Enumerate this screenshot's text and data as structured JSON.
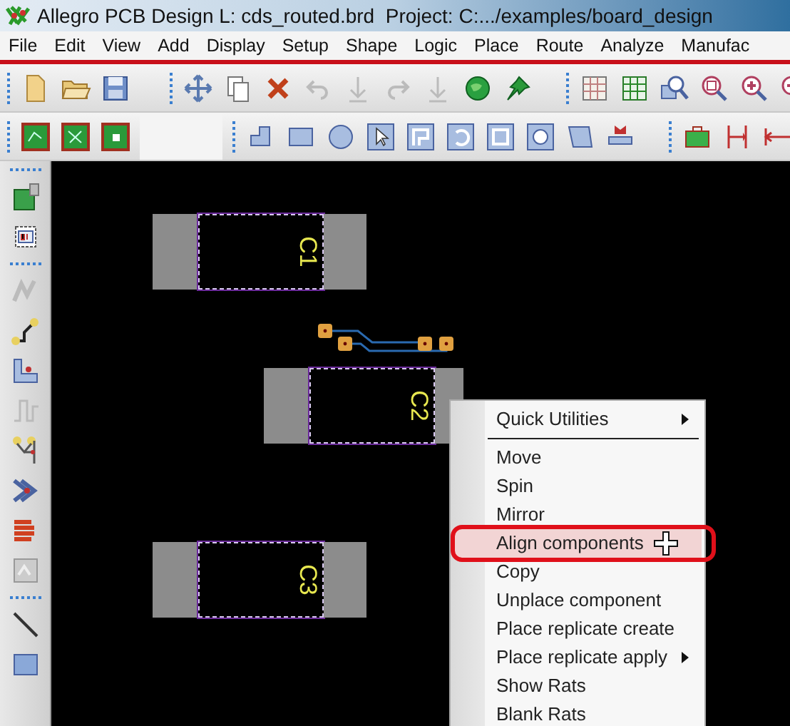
{
  "window": {
    "title": "Allegro PCB Design L: cds_routed.brd  Project: C:.../examples/board_design"
  },
  "menu_bar": [
    "File",
    "Edit",
    "View",
    "Add",
    "Display",
    "Setup",
    "Shape",
    "Logic",
    "Place",
    "Route",
    "Analyze",
    "Manufac"
  ],
  "canvas": {
    "components": [
      {
        "ref": "C1",
        "kind": "full"
      },
      {
        "ref": "C2",
        "kind": "partial"
      },
      {
        "ref": "C3",
        "kind": "full"
      }
    ]
  },
  "context_menu": {
    "items": [
      {
        "label": "Quick Utilities",
        "submenu": true,
        "selected": false,
        "separator_after": true
      },
      {
        "label": "Move",
        "submenu": false,
        "selected": false,
        "separator_after": false
      },
      {
        "label": "Spin",
        "submenu": false,
        "selected": false,
        "separator_after": false
      },
      {
        "label": "Mirror",
        "submenu": false,
        "selected": false,
        "separator_after": false
      },
      {
        "label": "Align components",
        "submenu": false,
        "selected": true,
        "separator_after": false
      },
      {
        "label": "Copy",
        "submenu": false,
        "selected": false,
        "separator_after": false
      },
      {
        "label": "Unplace component",
        "submenu": false,
        "selected": false,
        "separator_after": false
      },
      {
        "label": "Place replicate create",
        "submenu": false,
        "selected": false,
        "separator_after": false
      },
      {
        "label": "Place replicate apply",
        "submenu": true,
        "selected": false,
        "separator_after": false
      },
      {
        "label": "Show Rats",
        "submenu": false,
        "selected": false,
        "separator_after": false
      },
      {
        "label": "Blank Rats",
        "submenu": false,
        "selected": false,
        "separator_after": false
      }
    ]
  }
}
